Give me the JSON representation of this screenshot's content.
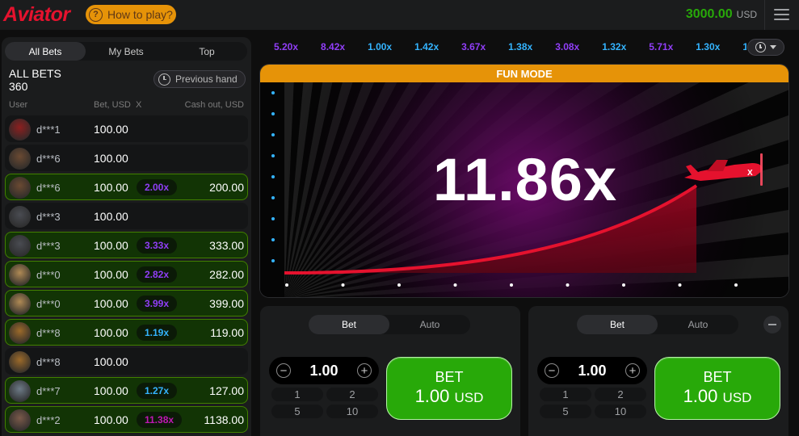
{
  "header": {
    "logo": "Aviator",
    "how_to_play": "How to play?",
    "balance": "3000.00",
    "currency": "USD",
    "colors": {
      "brand": "#e5122e",
      "accent": "#e69308",
      "green": "#28a909"
    }
  },
  "bets_panel": {
    "tabs": [
      "All Bets",
      "My Bets",
      "Top"
    ],
    "title": "ALL BETS",
    "count": "360",
    "previous_hand": "Previous hand",
    "columns": {
      "user": "User",
      "bet": "Bet, USD",
      "x": "X",
      "cashout": "Cash out, USD"
    },
    "rows": [
      {
        "user": "d***1",
        "bet": "100.00",
        "mult": "",
        "cashout": "",
        "win": false,
        "mult_color": "",
        "avatar": "#8d1f1f"
      },
      {
        "user": "d***6",
        "bet": "100.00",
        "mult": "",
        "cashout": "",
        "win": false,
        "mult_color": "",
        "avatar": "#6b4a32"
      },
      {
        "user": "d***6",
        "bet": "100.00",
        "mult": "2.00x",
        "cashout": "200.00",
        "win": true,
        "mult_color": "#913ef8",
        "avatar": "#6b4a32"
      },
      {
        "user": "d***3",
        "bet": "100.00",
        "mult": "",
        "cashout": "",
        "win": false,
        "mult_color": "",
        "avatar": "#4a4c52"
      },
      {
        "user": "d***3",
        "bet": "100.00",
        "mult": "3.33x",
        "cashout": "333.00",
        "win": true,
        "mult_color": "#913ef8",
        "avatar": "#4a4c52"
      },
      {
        "user": "d***0",
        "bet": "100.00",
        "mult": "2.82x",
        "cashout": "282.00",
        "win": true,
        "mult_color": "#913ef8",
        "avatar": "#b08a55"
      },
      {
        "user": "d***0",
        "bet": "100.00",
        "mult": "3.99x",
        "cashout": "399.00",
        "win": true,
        "mult_color": "#913ef8",
        "avatar": "#b08a55"
      },
      {
        "user": "d***8",
        "bet": "100.00",
        "mult": "1.19x",
        "cashout": "119.00",
        "win": true,
        "mult_color": "#34b4ff",
        "avatar": "#9c6a2a"
      },
      {
        "user": "d***8",
        "bet": "100.00",
        "mult": "",
        "cashout": "",
        "win": false,
        "mult_color": "",
        "avatar": "#9c6a2a"
      },
      {
        "user": "d***7",
        "bet": "100.00",
        "mult": "1.27x",
        "cashout": "127.00",
        "win": true,
        "mult_color": "#34b4ff",
        "avatar": "#6d7a86"
      },
      {
        "user": "d***2",
        "bet": "100.00",
        "mult": "11.38x",
        "cashout": "1138.00",
        "win": true,
        "mult_color": "#c017b4",
        "avatar": "#7a5a4a"
      }
    ]
  },
  "history": [
    {
      "v": "5.20x",
      "c": "#913ef8"
    },
    {
      "v": "8.42x",
      "c": "#913ef8"
    },
    {
      "v": "1.00x",
      "c": "#34b4ff"
    },
    {
      "v": "1.42x",
      "c": "#34b4ff"
    },
    {
      "v": "3.67x",
      "c": "#913ef8"
    },
    {
      "v": "1.38x",
      "c": "#34b4ff"
    },
    {
      "v": "3.08x",
      "c": "#913ef8"
    },
    {
      "v": "1.32x",
      "c": "#34b4ff"
    },
    {
      "v": "5.71x",
      "c": "#913ef8"
    },
    {
      "v": "1.30x",
      "c": "#34b4ff"
    },
    {
      "v": "1",
      "c": "#34b4ff"
    }
  ],
  "game": {
    "banner": "FUN MODE",
    "multiplier": "11.86x"
  },
  "bet_panels": [
    {
      "tabs": [
        "Bet",
        "Auto"
      ],
      "amount": "1.00",
      "quick": [
        "1",
        "2",
        "5",
        "10"
      ],
      "button_label": "BET",
      "button_amount": "1.00",
      "button_currency": "USD",
      "show_minus": false
    },
    {
      "tabs": [
        "Bet",
        "Auto"
      ],
      "amount": "1.00",
      "quick": [
        "1",
        "2",
        "5",
        "10"
      ],
      "button_label": "BET",
      "button_amount": "1.00",
      "button_currency": "USD",
      "show_minus": true
    }
  ]
}
